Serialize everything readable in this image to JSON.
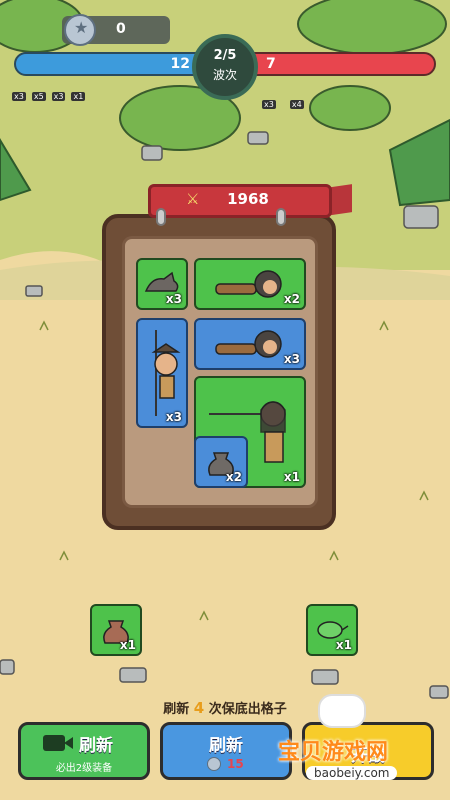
{
  "hud": {
    "coins": "0",
    "ally_count": "12",
    "enemy_count": "7",
    "wave": "2/5",
    "wave_label": "波次"
  },
  "field_units": {
    "left": [
      "x3",
      "x5",
      "x3",
      "x1"
    ],
    "right": [
      "x3",
      "x4"
    ]
  },
  "panel": {
    "power": "1968"
  },
  "tiles": [
    {
      "qty": "x3",
      "color": "green",
      "icon": "wolf-icon"
    },
    {
      "qty": "x2",
      "color": "green",
      "icon": "caveman-lying-icon"
    },
    {
      "qty": "x3",
      "color": "blue",
      "icon": "spear-warrior-icon"
    },
    {
      "qty": "x3",
      "color": "blue",
      "icon": "caveman-lying-icon"
    },
    {
      "qty": "x1",
      "color": "green",
      "icon": "spear-woman-icon"
    },
    {
      "qty": "x2",
      "color": "blue",
      "icon": "sack-icon"
    }
  ],
  "bench": [
    {
      "qty": "x1",
      "icon": "sack-icon"
    },
    {
      "qty": "x1",
      "icon": "lizard-icon"
    }
  ],
  "hint": {
    "prefix": "刷新",
    "count": "4",
    "suffix": "次保底出格子"
  },
  "buttons": {
    "video_refresh": {
      "title": "刷新",
      "subtitle": "必出2级装备"
    },
    "coin_refresh": {
      "title": "刷新",
      "cost": "15"
    },
    "confirm": {
      "title": "开战"
    }
  },
  "watermark": {
    "text": "宝贝游戏网",
    "url": "baobeiy.com"
  }
}
